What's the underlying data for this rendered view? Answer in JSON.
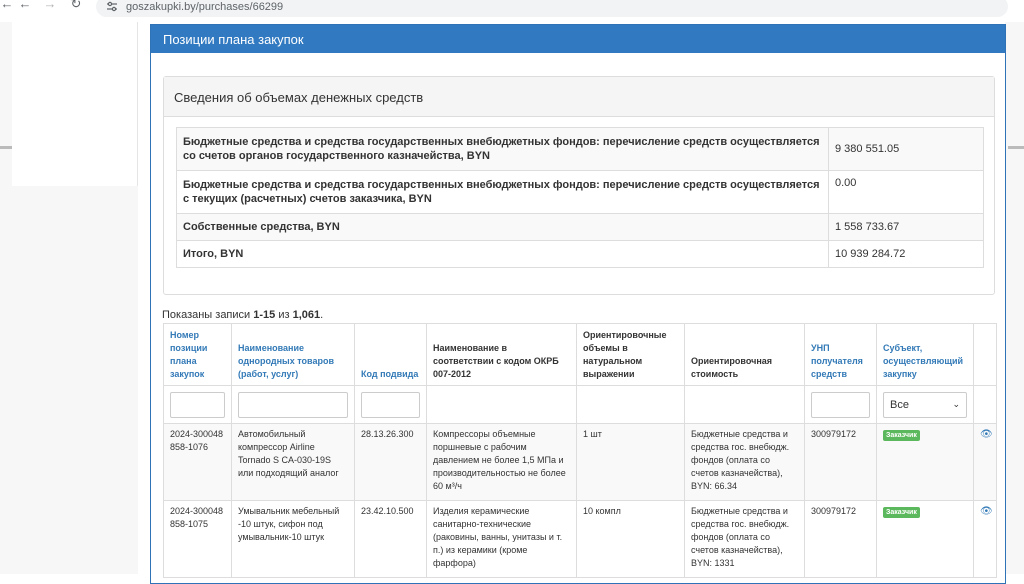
{
  "browser": {
    "url": "goszakupki.by/purchases/66299"
  },
  "panel": {
    "title": "Позиции плана закупок"
  },
  "funds": {
    "title": "Сведения об объемах денежных средств",
    "rows": [
      {
        "label": "Бюджетные средства и средства государственных внебюджетных фондов: перечисление средств осуществляется со счетов органов государственного казначейства, BYN",
        "value": "9 380 551.05"
      },
      {
        "label": "Бюджетные средства и средства государственных внебюджетных фондов: перечисление средств осуществляется с текущих (расчетных) счетов заказчика, BYN",
        "value": "0.00"
      },
      {
        "label": "Собственные средства, BYN",
        "value": "1 558 733.67"
      },
      {
        "label": "Итого, BYN",
        "value": "10 939 284.72"
      }
    ]
  },
  "summary": {
    "prefix": "Показаны записи ",
    "range": "1-15",
    "middle": " из ",
    "total": "1,061",
    "suffix": "."
  },
  "grid": {
    "headers": [
      "Номер позиции плана закупок",
      "Наименование однородных товаров (работ, услуг)",
      "Код подвида",
      "Наименование в соответствии с кодом ОКРБ 007-2012",
      "Ориентировочные объемы в натуральном выражении",
      "Ориентировочная стоимость",
      "УНП получателя средств",
      "Субъект, осуществляющий закупку"
    ],
    "filter_select": "Все",
    "rows": [
      {
        "number": "2024-300048858-1076",
        "name": "Автомобильный компрессор Airline Tornado S CA-030-19S или подходящий аналог",
        "code": "28.13.26.300",
        "okrb": "Компрессоры объемные поршневые с рабочим давлением не более 1,5 МПа и производительностью не более 60 м³/ч",
        "volume": "1 шт",
        "cost": "Бюджетные средства и средства гос. внебюдж. фондов (оплата со счетов казначейства), BYN: 66.34",
        "unp": "300979172",
        "subject": "Заказчик"
      },
      {
        "number": "2024-300048858-1075",
        "name": "Умывальник мебельный -10 штук, сифон под умывальник-10 штук",
        "code": "23.42.10.500",
        "okrb": "Изделия керамические санитарно-технические (раковины, ванны, унитазы и т. п.) из керамики (кроме фарфора)",
        "volume": "10 компл",
        "cost": "Бюджетные средства и средства гос. внебюдж. фондов (оплата со счетов казначейства), BYN: 1331",
        "unp": "300979172",
        "subject": "Заказчик"
      }
    ]
  }
}
